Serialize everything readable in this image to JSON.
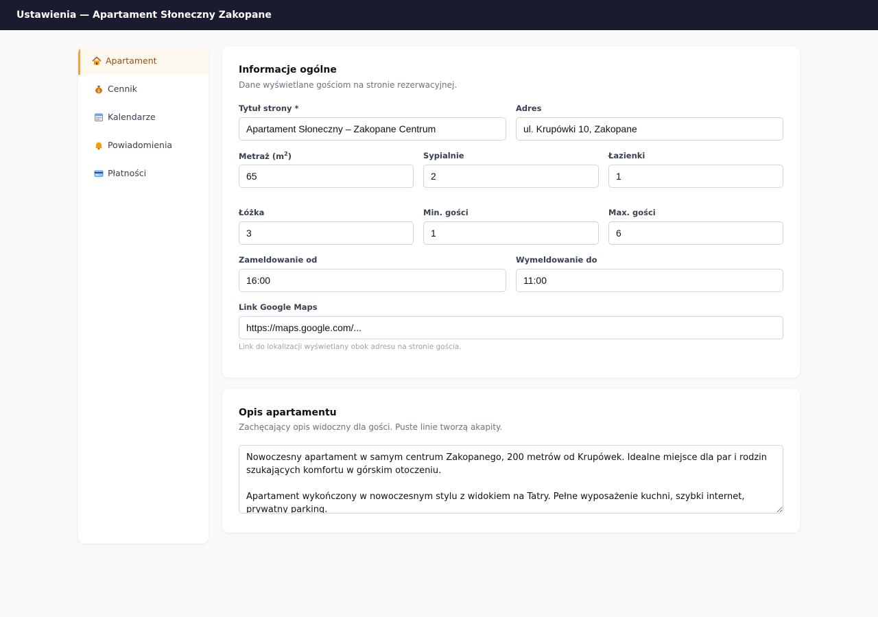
{
  "header": {
    "title": "Ustawienia — Apartament Słoneczny Zakopane"
  },
  "sidebar": {
    "items": [
      {
        "label": "Apartament",
        "icon": "house-icon",
        "active": true
      },
      {
        "label": "Cennik",
        "icon": "money-bag-icon"
      },
      {
        "label": "Kalendarze",
        "icon": "calendar-icon"
      },
      {
        "label": "Powiadomienia",
        "icon": "bell-icon"
      },
      {
        "label": "Płatności",
        "icon": "credit-card-icon"
      }
    ]
  },
  "general": {
    "title": "Informacje ogólne",
    "subtitle": "Dane wyświetlane gościom na stronie rezerwacyjnej.",
    "page_title_label": "Tytuł strony *",
    "page_title_value": "Apartament Słoneczny – Zakopane Centrum",
    "address_label": "Adres",
    "address_value": "ul. Krupówki 10, Zakopane",
    "area_label": "Metraż (m",
    "area_label_sup": "2",
    "area_label_end": ")",
    "area_value": "65",
    "bedrooms_label": "Sypialnie",
    "bedrooms_value": "2",
    "bathrooms_label": "Łazienki",
    "bathrooms_value": "1",
    "beds_label": "Łóżka",
    "beds_value": "3",
    "min_guests_label": "Min. gości",
    "min_guests_value": "1",
    "max_guests_label": "Max. gości",
    "max_guests_value": "6",
    "checkin_label": "Zameldowanie od",
    "checkin_value": "16:00",
    "checkout_label": "Wymeldowanie do",
    "checkout_value": "11:00",
    "maps_label": "Link Google Maps",
    "maps_value": "https://maps.google.com/...",
    "maps_hint": "Link do lokalizacji wyświetlany obok adresu na stronie gościa."
  },
  "description": {
    "title": "Opis apartamentu",
    "subtitle": "Zachęcający opis widoczny dla gości. Puste linie tworzą akapity.",
    "value": "Nowoczesny apartament w samym centrum Zakopanego, 200 metrów od Krupówek. Idealne miejsce dla par i rodzin szukających komfortu w górskim otoczeniu.\n\nApartament wykończony w nowoczesnym stylu z widokiem na Tatry. Pełne wyposażenie kuchni, szybki internet, prywatny parking."
  }
}
